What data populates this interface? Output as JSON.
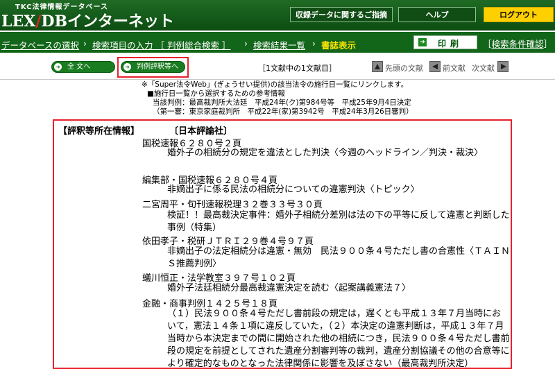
{
  "header": {
    "brand_sub": "TKC法律情報データベース",
    "brand_lex": "LEX",
    "brand_slash": "/",
    "brand_db": "DBインターネット",
    "btn_feedback": "収録データに関するご指摘",
    "btn_help": "ヘルプ",
    "btn_logout": "ログアウト"
  },
  "breadcrumb": {
    "items": [
      "データベースの選択",
      "検索項目の入力 ［ 判例総合検索 ］",
      "検索結果一覧"
    ],
    "separator": "›",
    "current": "書誌表示"
  },
  "print_label": "印刷",
  "search_cond": {
    "open": "［",
    "label": "検索条件確認",
    "close": "］"
  },
  "toolbar": {
    "fulltext": "全 文へ",
    "hyoshaku": "判例評釈等へ",
    "doc_count": "［1文献中の1文献目］",
    "first_doc": "先頭の文献",
    "prev_doc": "前文献",
    "next_doc": "次文献"
  },
  "info": {
    "line1": "※「Super法令Web」(ぎょうせい提供)の該当法令の施行日一覧にリンクします。",
    "line2": "■施行日一覧から選択するための参考情報",
    "line3": "当該判例：最高裁判所大法廷　平成24年(ク)第984号等　平成25年9月4日決定",
    "line4": "（第一審：東京家庭裁判所　平成22年(家)第3942号　平成24年3月26日審判）"
  },
  "hyoshaku_section": {
    "title": "【評釈等所在情報】",
    "publisher": "〔日本評論社〕",
    "entries": [
      {
        "source": "国税速報６２８０号２頁",
        "title": "婚外子の相続分の規定を違法とした判決〈今週のヘッドライン／判決・裁決〉"
      },
      {
        "source": "編集部・国税速報６２８０号４頁",
        "title": "非嫡出子に係る民法の相続分についての違憲判決〈トピック〉"
      },
      {
        "source": "二宮周平・旬刊速報税理３２巻３３号３０頁",
        "title": "検証！！最高裁決定事件：婚外子相続分差別は法の下の平等に反して違憲と判断した事例（特集）"
      },
      {
        "source": "依田孝子・税研ＪＴＲＩ２９巻４号９７頁",
        "title": "非嫡出子の法定相続分は違憲・無効　民法９００条４号ただし書の合憲性〈ＴＡＩＮＳ推薦判例〉"
      },
      {
        "source": "蟻川恒正・法学教室３９７号１０２頁",
        "title": "婚外子法廷相続分最高裁違憲決定を読む〈起案講義憲法７〉"
      },
      {
        "source": "金融・商事判例１４２５号１８頁",
        "title": "（１）民法９００条４号ただし書前段の規定は，遅くとも平成１３年７月当時において，憲法１４条１項に違反していた，（２）本決定の違憲判断は，平成１３年７月当時から本決定までの間に開始された他の相続につき，民法９００条４号ただし書前段の規定を前提としてされた遺産分割審判等の裁判，遺産分割協議その他の合意等により確定的なものとなった法律関係に影響を及ぼさない（最高裁判所決定）"
      }
    ]
  }
}
